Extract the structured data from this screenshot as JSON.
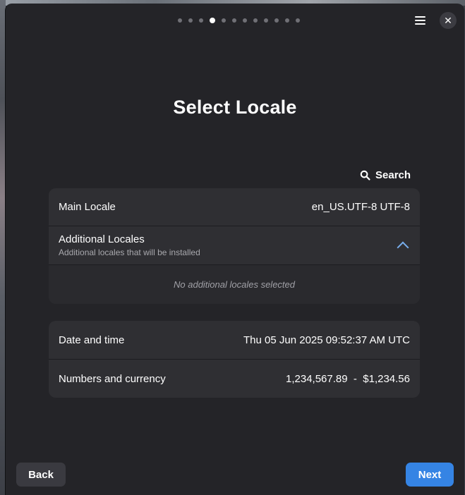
{
  "header": {
    "page_indicator": {
      "total": 12,
      "current": 4
    },
    "menu_icon": "hamburger-menu-icon",
    "close_icon": "close-icon",
    "close_glyph": "✕"
  },
  "title": "Select Locale",
  "search": {
    "label": "Search",
    "icon": "search-icon"
  },
  "locale_card": {
    "main_locale_label": "Main Locale",
    "main_locale_value": "en_US.UTF-8 UTF-8",
    "additional_label": "Additional Locales",
    "additional_subtitle": "Additional locales that will be installed",
    "empty_message": "No additional locales selected"
  },
  "format_card": {
    "date_label": "Date and time",
    "date_value": "Thu 05 Jun 2025 09:52:37 AM UTC",
    "numbers_label": "Numbers and currency",
    "numbers_value": "1,234,567.89  -  $1,234.56"
  },
  "footer": {
    "back_label": "Back",
    "next_label": "Next"
  },
  "colors": {
    "accent": "#3584e4",
    "window_bg": "#242428",
    "card_bg": "#2f2f33",
    "chevron": "#78aeed"
  }
}
